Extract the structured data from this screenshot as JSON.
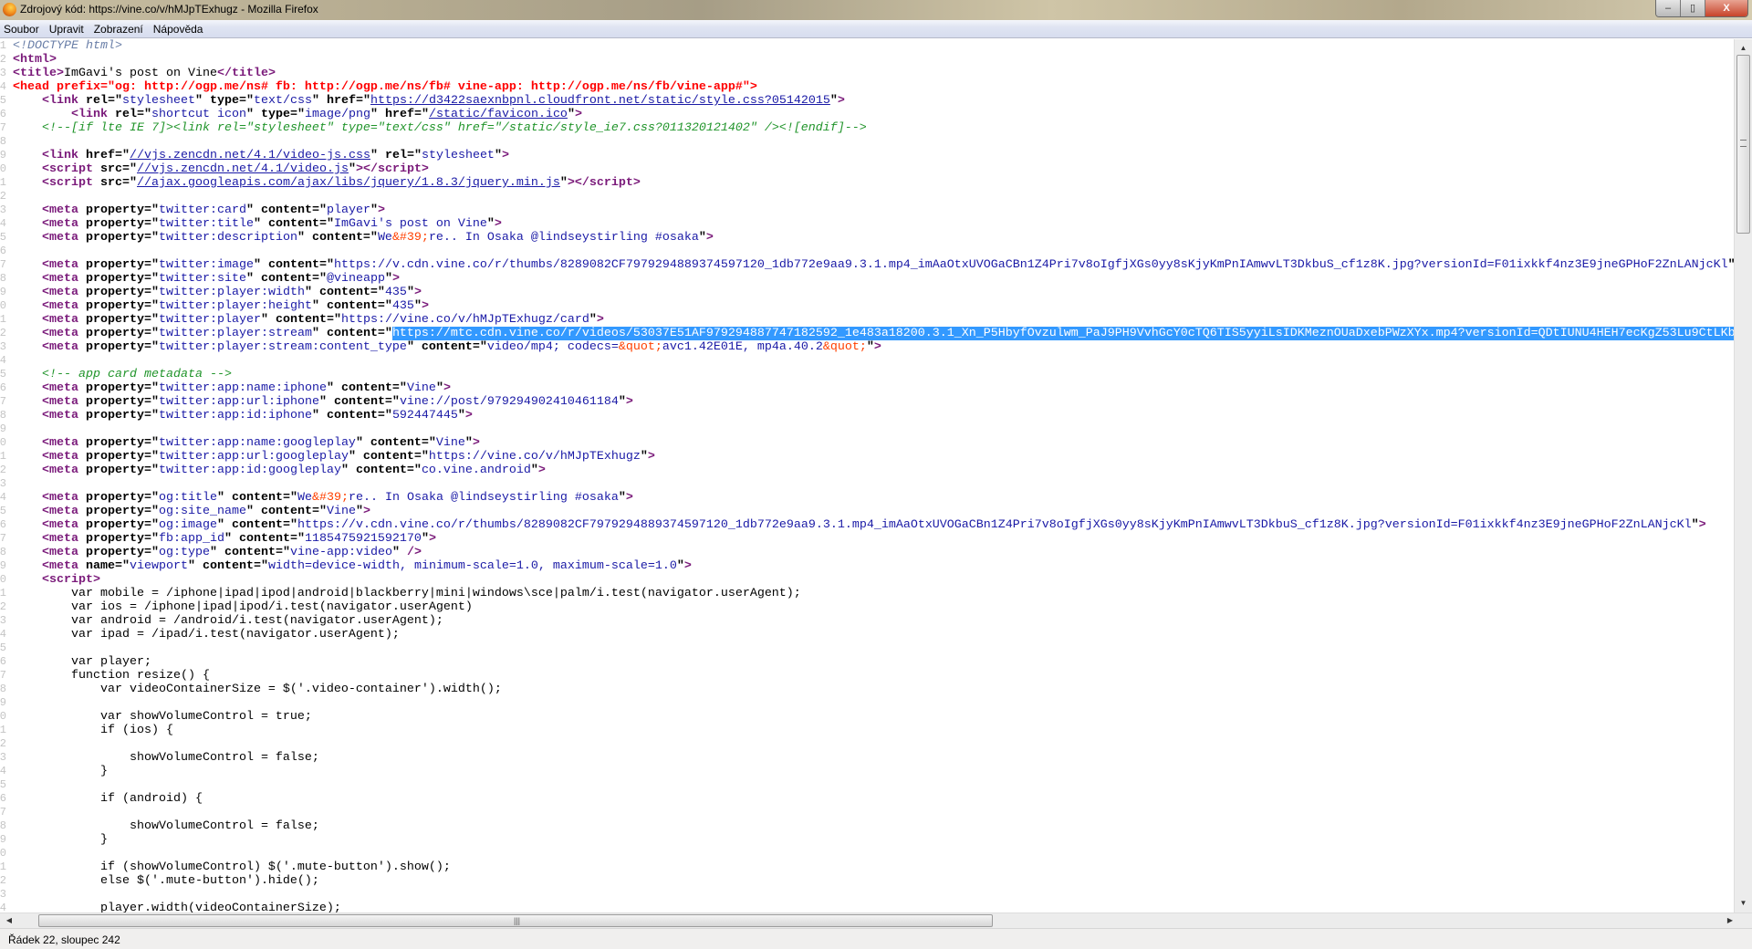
{
  "window": {
    "title": "Zdrojový kód: https://vine.co/v/hMJpTExhugz - Mozilla Firefox",
    "buttons": {
      "minimize": "–",
      "restore": "▯",
      "close": "X"
    }
  },
  "menu": [
    "Soubor",
    "Upravit",
    "Zobrazení",
    "Nápověda"
  ],
  "status": "Řádek 22, sloupec 242",
  "code": {
    "first_line_number": 1,
    "lines": [
      [
        [
          "d",
          "<!DOCTYPE html>"
        ]
      ],
      [
        [
          "t",
          "<html>"
        ]
      ],
      [
        [
          "t",
          "<title>"
        ],
        [
          "p",
          "ImGavi's post on Vine"
        ],
        [
          "t",
          "</title>"
        ]
      ],
      [
        [
          "r",
          "<head prefix=\"og: http://ogp.me/ns# fb: http://ogp.me/ns/fb# vine-app: http://ogp.me/ns/fb/vine-app#\">"
        ]
      ],
      [
        [
          "p",
          "    "
        ],
        [
          "t",
          "<link"
        ],
        [
          "a",
          " rel=\""
        ],
        [
          "v",
          "stylesheet"
        ],
        [
          "a",
          "\" type=\""
        ],
        [
          "v",
          "text/css"
        ],
        [
          "a",
          "\" href=\""
        ],
        [
          "u",
          "https://d3422saexnbpnl.cloudfront.net/static/style.css?05142015"
        ],
        [
          "a",
          "\""
        ],
        [
          "t",
          ">"
        ]
      ],
      [
        [
          "p",
          "        "
        ],
        [
          "t",
          "<link"
        ],
        [
          "a",
          " rel=\""
        ],
        [
          "v",
          "shortcut icon"
        ],
        [
          "a",
          "\" type=\""
        ],
        [
          "v",
          "image/png"
        ],
        [
          "a",
          "\" href=\""
        ],
        [
          "u",
          "/static/favicon.ico"
        ],
        [
          "a",
          "\""
        ],
        [
          "t",
          ">"
        ]
      ],
      [
        [
          "p",
          "    "
        ],
        [
          "c",
          "<!--[if lte IE 7]><link rel=\"stylesheet\" type=\"text/css\" href=\"/static/style_ie7.css?011320121402\" /><![endif]-->"
        ]
      ],
      [],
      [
        [
          "p",
          "    "
        ],
        [
          "t",
          "<link"
        ],
        [
          "a",
          " href=\""
        ],
        [
          "u",
          "//vjs.zencdn.net/4.1/video-js.css"
        ],
        [
          "a",
          "\" rel=\""
        ],
        [
          "v",
          "stylesheet"
        ],
        [
          "a",
          "\""
        ],
        [
          "t",
          ">"
        ]
      ],
      [
        [
          "p",
          "    "
        ],
        [
          "t",
          "<script"
        ],
        [
          "a",
          " src=\""
        ],
        [
          "u",
          "//vjs.zencdn.net/4.1/video.js"
        ],
        [
          "a",
          "\""
        ],
        [
          "t",
          "></script>"
        ]
      ],
      [
        [
          "p",
          "    "
        ],
        [
          "t",
          "<script"
        ],
        [
          "a",
          " src=\""
        ],
        [
          "u",
          "//ajax.googleapis.com/ajax/libs/jquery/1.8.3/jquery.min.js"
        ],
        [
          "a",
          "\""
        ],
        [
          "t",
          "></script>"
        ]
      ],
      [],
      [
        [
          "p",
          "    "
        ],
        [
          "t",
          "<meta"
        ],
        [
          "a",
          " property=\""
        ],
        [
          "v",
          "twitter:card"
        ],
        [
          "a",
          "\" content=\""
        ],
        [
          "v",
          "player"
        ],
        [
          "a",
          "\""
        ],
        [
          "t",
          ">"
        ]
      ],
      [
        [
          "p",
          "    "
        ],
        [
          "t",
          "<meta"
        ],
        [
          "a",
          " property=\""
        ],
        [
          "v",
          "twitter:title"
        ],
        [
          "a",
          "\" content=\""
        ],
        [
          "v",
          "ImGavi's post on Vine"
        ],
        [
          "a",
          "\""
        ],
        [
          "t",
          ">"
        ]
      ],
      [
        [
          "p",
          "    "
        ],
        [
          "t",
          "<meta"
        ],
        [
          "a",
          " property=\""
        ],
        [
          "v",
          "twitter:description"
        ],
        [
          "a",
          "\" content=\""
        ],
        [
          "v",
          "We"
        ],
        [
          "e",
          "&#39;"
        ],
        [
          "v",
          "re.. In Osaka @lindseystirling #osaka"
        ],
        [
          "a",
          "\""
        ],
        [
          "t",
          ">"
        ]
      ],
      [],
      [
        [
          "p",
          "    "
        ],
        [
          "t",
          "<meta"
        ],
        [
          "a",
          " property=\""
        ],
        [
          "v",
          "twitter:image"
        ],
        [
          "a",
          "\" content=\""
        ],
        [
          "v",
          "https://v.cdn.vine.co/r/thumbs/8289082CF7979294889374597120_1db772e9aa9.3.1.mp4_imAaOtxUVOGaCBn1Z4Pri7v8oIgfjXGs0yy8sKjyKmPnIAmwvLT3DkbuS_cf1z8K.jpg?versionId=F01ixkkf4nz3E9jneGPHoF2ZnLANjcKl"
        ],
        [
          "a",
          "\""
        ],
        [
          "t",
          ">"
        ]
      ],
      [
        [
          "p",
          "    "
        ],
        [
          "t",
          "<meta"
        ],
        [
          "a",
          " property=\""
        ],
        [
          "v",
          "twitter:site"
        ],
        [
          "a",
          "\" content=\""
        ],
        [
          "v",
          "@vineapp"
        ],
        [
          "a",
          "\""
        ],
        [
          "t",
          ">"
        ]
      ],
      [
        [
          "p",
          "    "
        ],
        [
          "t",
          "<meta"
        ],
        [
          "a",
          " property=\""
        ],
        [
          "v",
          "twitter:player:width"
        ],
        [
          "a",
          "\" content=\""
        ],
        [
          "v",
          "435"
        ],
        [
          "a",
          "\""
        ],
        [
          "t",
          ">"
        ]
      ],
      [
        [
          "p",
          "    "
        ],
        [
          "t",
          "<meta"
        ],
        [
          "a",
          " property=\""
        ],
        [
          "v",
          "twitter:player:height"
        ],
        [
          "a",
          "\" content=\""
        ],
        [
          "v",
          "435"
        ],
        [
          "a",
          "\""
        ],
        [
          "t",
          ">"
        ]
      ],
      [
        [
          "p",
          "    "
        ],
        [
          "t",
          "<meta"
        ],
        [
          "a",
          " property=\""
        ],
        [
          "v",
          "twitter:player"
        ],
        [
          "a",
          "\" content=\""
        ],
        [
          "v",
          "https://vine.co/v/hMJpTExhugz/card"
        ],
        [
          "a",
          "\""
        ],
        [
          "t",
          ">"
        ]
      ],
      [
        [
          "p",
          "    "
        ],
        [
          "t",
          "<meta"
        ],
        [
          "a",
          " property=\""
        ],
        [
          "v",
          "twitter:player:stream"
        ],
        [
          "a",
          "\" content=\""
        ],
        [
          "s",
          "https://mtc.cdn.vine.co/r/videos/53037E51AF979294887747182592_1e483a18200.3.1_Xn_P5HbyfOvzulwm_PaJ9PH9VvhGcY0cTQ6TIS5yyiLsIDKMeznOUaDxebPWzXYx.mp4?versionId=QDtIUNU4HEH7ecKgZ53Lu9CtLKb"
        ]
      ],
      [
        [
          "p",
          "    "
        ],
        [
          "t",
          "<meta"
        ],
        [
          "a",
          " property=\""
        ],
        [
          "v",
          "twitter:player:stream:content_type"
        ],
        [
          "a",
          "\" content=\""
        ],
        [
          "v",
          "video/mp4; codecs="
        ],
        [
          "e",
          "&quot;"
        ],
        [
          "v",
          "avc1.42E01E, mp4a.40.2"
        ],
        [
          "e",
          "&quot;"
        ],
        [
          "a",
          "\""
        ],
        [
          "t",
          ">"
        ]
      ],
      [],
      [
        [
          "p",
          "    "
        ],
        [
          "c",
          "<!-- app card metadata -->"
        ]
      ],
      [
        [
          "p",
          "    "
        ],
        [
          "t",
          "<meta"
        ],
        [
          "a",
          " property=\""
        ],
        [
          "v",
          "twitter:app:name:iphone"
        ],
        [
          "a",
          "\" content=\""
        ],
        [
          "v",
          "Vine"
        ],
        [
          "a",
          "\""
        ],
        [
          "t",
          ">"
        ]
      ],
      [
        [
          "p",
          "    "
        ],
        [
          "t",
          "<meta"
        ],
        [
          "a",
          " property=\""
        ],
        [
          "v",
          "twitter:app:url:iphone"
        ],
        [
          "a",
          "\" content=\""
        ],
        [
          "v",
          "vine://post/979294902410461184"
        ],
        [
          "a",
          "\""
        ],
        [
          "t",
          ">"
        ]
      ],
      [
        [
          "p",
          "    "
        ],
        [
          "t",
          "<meta"
        ],
        [
          "a",
          " property=\""
        ],
        [
          "v",
          "twitter:app:id:iphone"
        ],
        [
          "a",
          "\" content=\""
        ],
        [
          "v",
          "592447445"
        ],
        [
          "a",
          "\""
        ],
        [
          "t",
          ">"
        ]
      ],
      [],
      [
        [
          "p",
          "    "
        ],
        [
          "t",
          "<meta"
        ],
        [
          "a",
          " property=\""
        ],
        [
          "v",
          "twitter:app:name:googleplay"
        ],
        [
          "a",
          "\" content=\""
        ],
        [
          "v",
          "Vine"
        ],
        [
          "a",
          "\""
        ],
        [
          "t",
          ">"
        ]
      ],
      [
        [
          "p",
          "    "
        ],
        [
          "t",
          "<meta"
        ],
        [
          "a",
          " property=\""
        ],
        [
          "v",
          "twitter:app:url:googleplay"
        ],
        [
          "a",
          "\" content=\""
        ],
        [
          "v",
          "https://vine.co/v/hMJpTExhugz"
        ],
        [
          "a",
          "\""
        ],
        [
          "t",
          ">"
        ]
      ],
      [
        [
          "p",
          "    "
        ],
        [
          "t",
          "<meta"
        ],
        [
          "a",
          " property=\""
        ],
        [
          "v",
          "twitter:app:id:googleplay"
        ],
        [
          "a",
          "\" content=\""
        ],
        [
          "v",
          "co.vine.android"
        ],
        [
          "a",
          "\""
        ],
        [
          "t",
          ">"
        ]
      ],
      [],
      [
        [
          "p",
          "    "
        ],
        [
          "t",
          "<meta"
        ],
        [
          "a",
          " property=\""
        ],
        [
          "v",
          "og:title"
        ],
        [
          "a",
          "\" content=\""
        ],
        [
          "v",
          "We"
        ],
        [
          "e",
          "&#39;"
        ],
        [
          "v",
          "re.. In Osaka @lindseystirling #osaka"
        ],
        [
          "a",
          "\""
        ],
        [
          "t",
          ">"
        ]
      ],
      [
        [
          "p",
          "    "
        ],
        [
          "t",
          "<meta"
        ],
        [
          "a",
          " property=\""
        ],
        [
          "v",
          "og:site_name"
        ],
        [
          "a",
          "\" content=\""
        ],
        [
          "v",
          "Vine"
        ],
        [
          "a",
          "\""
        ],
        [
          "t",
          ">"
        ]
      ],
      [
        [
          "p",
          "    "
        ],
        [
          "t",
          "<meta"
        ],
        [
          "a",
          " property=\""
        ],
        [
          "v",
          "og:image"
        ],
        [
          "a",
          "\" content=\""
        ],
        [
          "v",
          "https://v.cdn.vine.co/r/thumbs/8289082CF7979294889374597120_1db772e9aa9.3.1.mp4_imAaOtxUVOGaCBn1Z4Pri7v8oIgfjXGs0yy8sKjyKmPnIAmwvLT3DkbuS_cf1z8K.jpg?versionId=F01ixkkf4nz3E9jneGPHoF2ZnLANjcKl"
        ],
        [
          "a",
          "\""
        ],
        [
          "t",
          ">"
        ]
      ],
      [
        [
          "p",
          "    "
        ],
        [
          "t",
          "<meta"
        ],
        [
          "a",
          " property=\""
        ],
        [
          "v",
          "fb:app_id"
        ],
        [
          "a",
          "\" content=\""
        ],
        [
          "v",
          "1185475921592170"
        ],
        [
          "a",
          "\""
        ],
        [
          "t",
          ">"
        ]
      ],
      [
        [
          "p",
          "    "
        ],
        [
          "t",
          "<meta"
        ],
        [
          "a",
          " property=\""
        ],
        [
          "v",
          "og:type"
        ],
        [
          "a",
          "\" content=\""
        ],
        [
          "v",
          "vine-app:video"
        ],
        [
          "a",
          "\""
        ],
        [
          "t",
          " />"
        ]
      ],
      [
        [
          "p",
          "    "
        ],
        [
          "t",
          "<meta"
        ],
        [
          "a",
          " name=\""
        ],
        [
          "v",
          "viewport"
        ],
        [
          "a",
          "\" content=\""
        ],
        [
          "v",
          "width=device-width, minimum-scale=1.0, maximum-scale=1.0"
        ],
        [
          "a",
          "\""
        ],
        [
          "t",
          ">"
        ]
      ],
      [
        [
          "p",
          "    "
        ],
        [
          "t",
          "<script>"
        ]
      ],
      [
        [
          "p",
          "        var mobile = /iphone|ipad|ipod|android|blackberry|mini|windows\\sce|palm/i.test(navigator.userAgent);"
        ]
      ],
      [
        [
          "p",
          "        var ios = /iphone|ipad|ipod/i.test(navigator.userAgent)"
        ]
      ],
      [
        [
          "p",
          "        var android = /android/i.test(navigator.userAgent);"
        ]
      ],
      [
        [
          "p",
          "        var ipad = /ipad/i.test(navigator.userAgent);"
        ]
      ],
      [],
      [
        [
          "p",
          "        var player;"
        ]
      ],
      [
        [
          "p",
          "        function resize() {"
        ]
      ],
      [
        [
          "p",
          "            var videoContainerSize = $('.video-container').width();"
        ]
      ],
      [],
      [
        [
          "p",
          "            var showVolumeControl = true;"
        ]
      ],
      [
        [
          "p",
          "            if (ios) {"
        ]
      ],
      [],
      [
        [
          "p",
          "                showVolumeControl = false;"
        ]
      ],
      [
        [
          "p",
          "            }"
        ]
      ],
      [],
      [
        [
          "p",
          "            if (android) {"
        ]
      ],
      [],
      [
        [
          "p",
          "                showVolumeControl = false;"
        ]
      ],
      [
        [
          "p",
          "            }"
        ]
      ],
      [],
      [
        [
          "p",
          "            if (showVolumeControl) $('.mute-button').show();"
        ]
      ],
      [
        [
          "p",
          "            else $('.mute-button').hide();"
        ]
      ],
      [],
      [
        [
          "p",
          "            player.width(videoContainerSize);"
        ]
      ]
    ]
  }
}
